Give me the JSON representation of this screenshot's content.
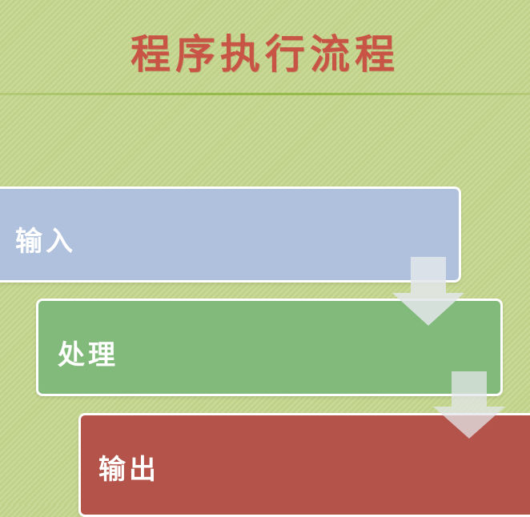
{
  "title": "程序执行流程",
  "steps": [
    {
      "label": "输入",
      "color": "#b0c1dd"
    },
    {
      "label": "处理",
      "color": "#82ba7c"
    },
    {
      "label": "输出",
      "color": "#b4534a"
    }
  ],
  "arrow_color": "#e3e6ea"
}
